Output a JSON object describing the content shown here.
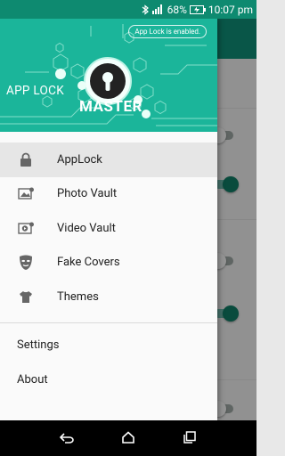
{
  "status_bar": {
    "battery": "68%",
    "time": "10:07 pm"
  },
  "drawer": {
    "header": {
      "status_pill": "App Lock is enabled.",
      "brand_line1": "APP LOCK",
      "brand_line2": "MASTER"
    },
    "items": [
      {
        "label": "AppLock",
        "icon": "lock-icon",
        "selected": true
      },
      {
        "label": "Photo Vault",
        "icon": "photo-vault-icon"
      },
      {
        "label": "Video Vault",
        "icon": "video-vault-icon"
      },
      {
        "label": "Fake Covers",
        "icon": "mask-icon"
      },
      {
        "label": "Themes",
        "icon": "shirt-icon"
      }
    ],
    "secondary": [
      {
        "label": "Settings"
      },
      {
        "label": "About"
      }
    ]
  },
  "colors": {
    "accent": "#1bb59a",
    "toolbar": "#0f8c74",
    "status_bar": "#0e8a70",
    "toggle_on": "#0f7a63"
  }
}
